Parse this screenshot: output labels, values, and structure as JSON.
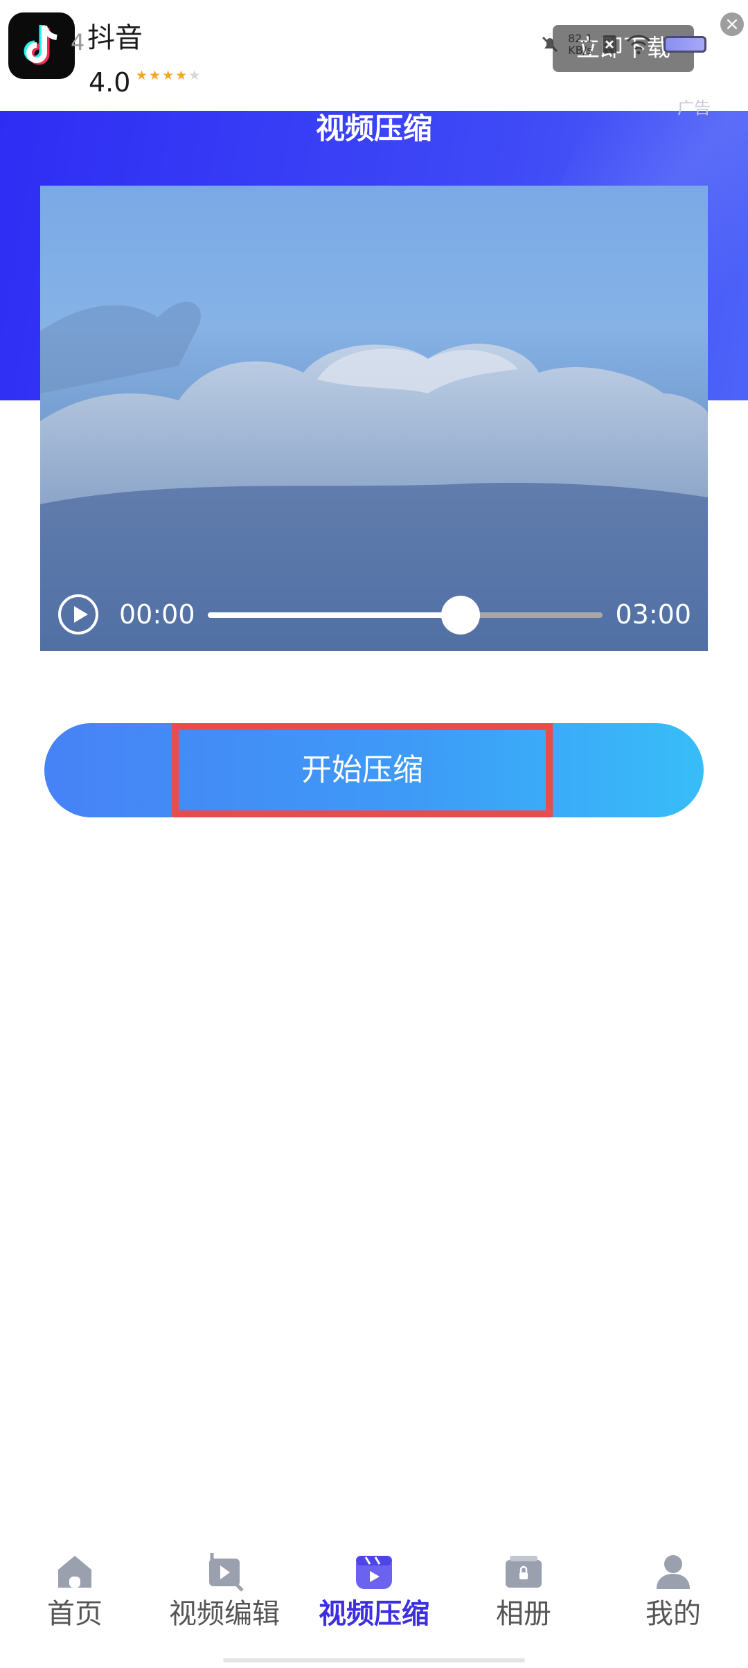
{
  "ad": {
    "app_name": "抖音",
    "rating": "4.0",
    "stars": 4,
    "max_stars": 5,
    "download_label": "立即下载",
    "close_icon": "close-icon",
    "label": "广告",
    "status_residue": "4",
    "network_speed": "82.1",
    "network_speed_unit": "KB/s"
  },
  "header": {
    "title": "视频压缩",
    "color_start": "#2e2df4",
    "color_end": "#4d63f8"
  },
  "video": {
    "current_time": "00:00",
    "total_time": "03:00",
    "progress": 0.64,
    "play_icon": "play-icon"
  },
  "action": {
    "start_label": "开始压缩",
    "highlight_color": "#e94c4c"
  },
  "bottom_nav": {
    "active_index": 2,
    "active_color": "#3c2fe0",
    "items": [
      {
        "label": "首页",
        "icon": "home-icon"
      },
      {
        "label": "视频编辑",
        "icon": "video-edit-icon"
      },
      {
        "label": "视频压缩",
        "icon": "video-compress-icon"
      },
      {
        "label": "相册",
        "icon": "album-icon"
      },
      {
        "label": "我的",
        "icon": "profile-icon"
      }
    ]
  }
}
